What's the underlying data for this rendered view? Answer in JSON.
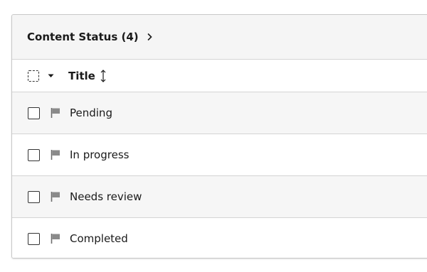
{
  "panel": {
    "title": "Content Status (4)"
  },
  "table": {
    "column_title": "Title",
    "rows": [
      {
        "label": "Pending"
      },
      {
        "label": "In progress"
      },
      {
        "label": "Needs review"
      },
      {
        "label": "Completed"
      }
    ]
  },
  "icons": {
    "header_expand": "chevron-right-icon",
    "select_dropdown": "caret-down-icon",
    "sort": "sort-vertical-icon",
    "row_flag": "flag-icon"
  },
  "colors": {
    "flag": "#8a8a8a",
    "border": "#d4d4d4",
    "header_bg": "#f5f5f5"
  }
}
